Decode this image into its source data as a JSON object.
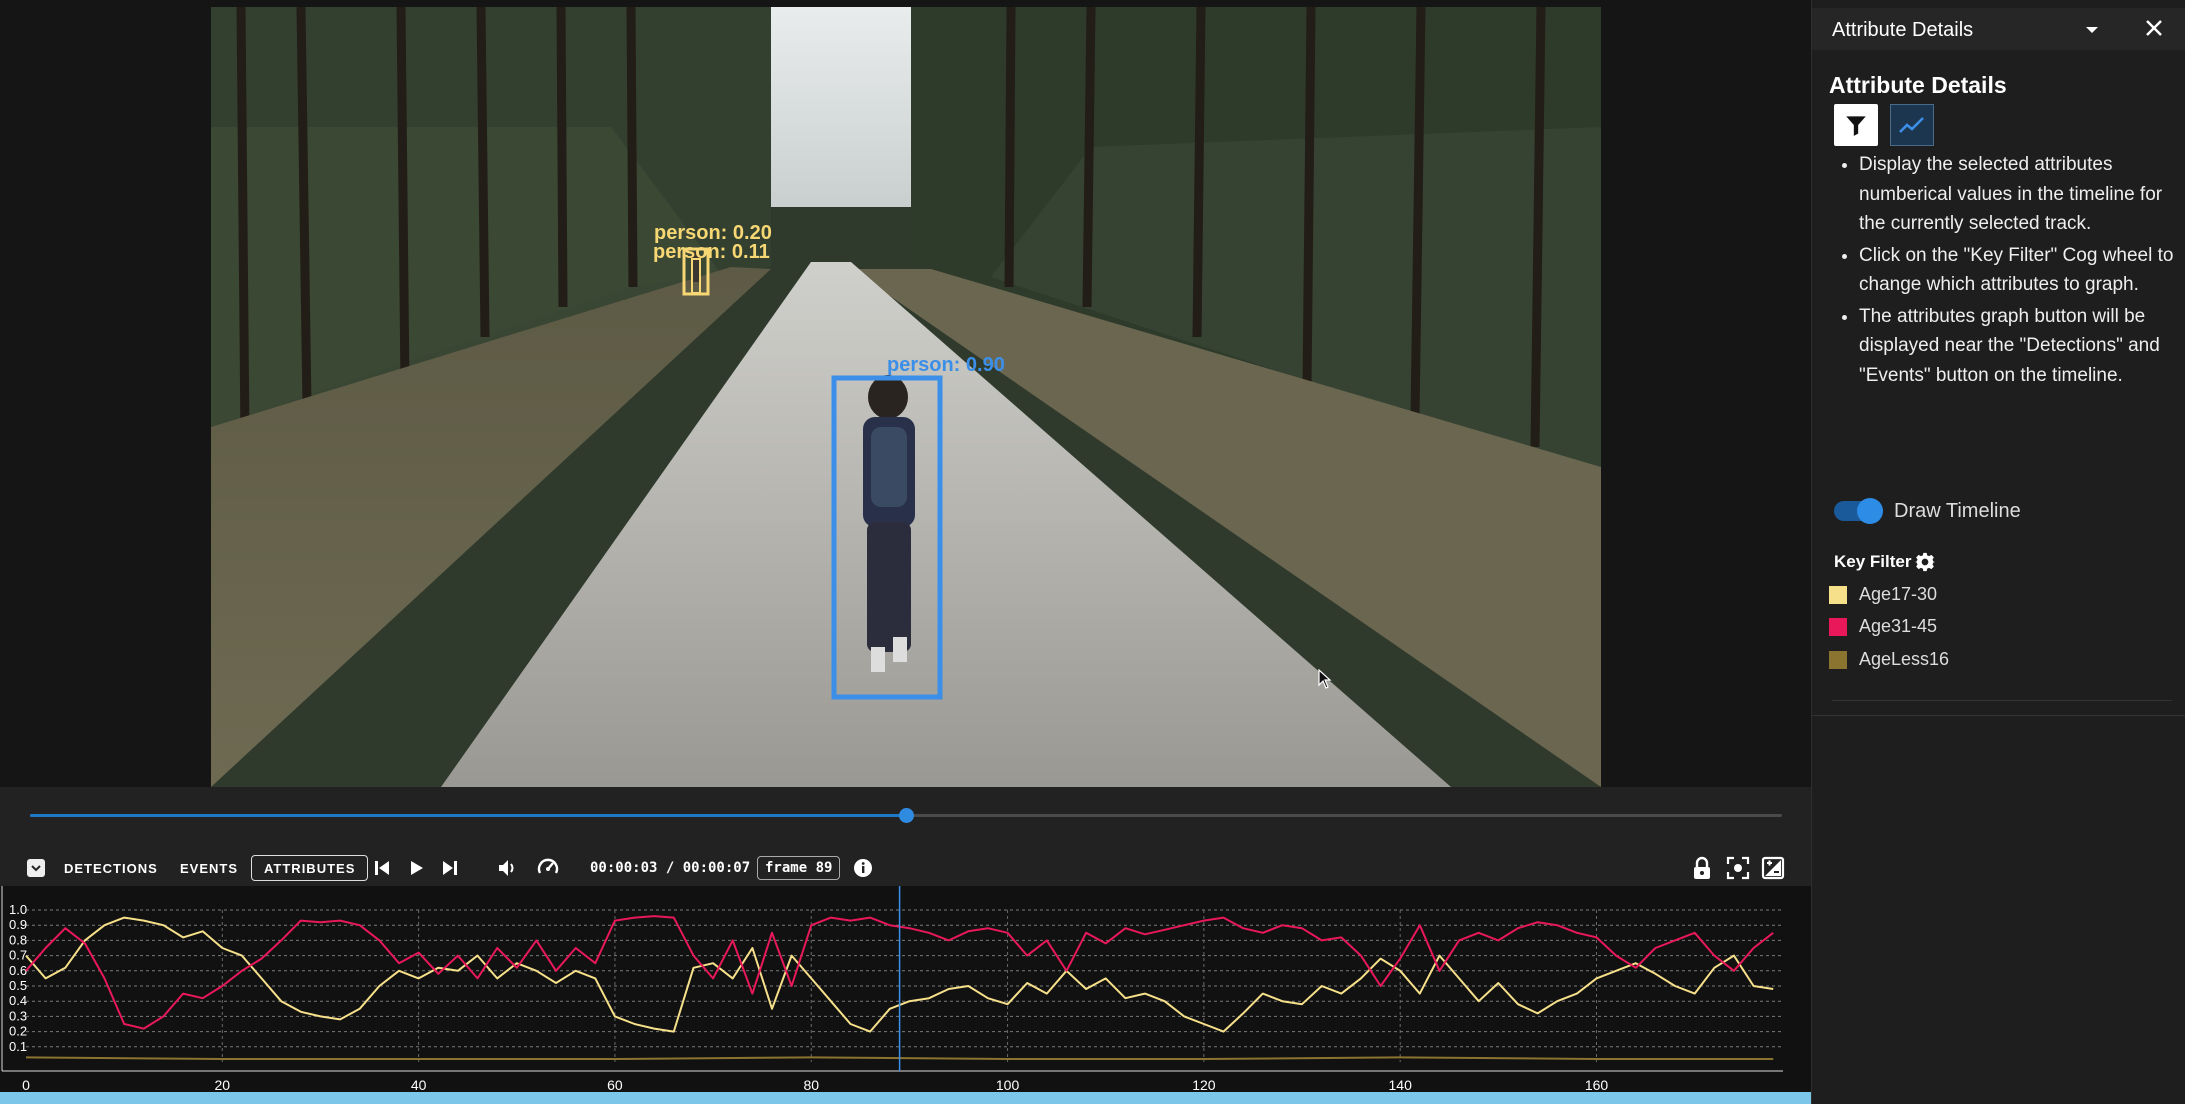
{
  "video": {
    "detections": [
      {
        "label": "person: 0.20",
        "color": "#f7d774"
      },
      {
        "label": "person: 0.11",
        "color": "#f7d774"
      },
      {
        "label": "person: 0.90",
        "color": "#3b8fe8"
      }
    ]
  },
  "controls": {
    "tabs": [
      "DETECTIONS",
      "EVENTS",
      "ATTRIBUTES"
    ],
    "active_tab": "ATTRIBUTES",
    "time": "00:00:03 / 00:00:07",
    "frame": "frame 89",
    "seek_progress": 0.5
  },
  "timeline": {
    "x_ticks": [
      "0",
      "20",
      "40",
      "60",
      "80",
      "100",
      "120",
      "140",
      "160"
    ],
    "y_ticks": [
      "1.0",
      "0.9",
      "0.8",
      "0.7",
      "0.6",
      "0.5",
      "0.4",
      "0.3",
      "0.2",
      "0.1"
    ]
  },
  "chart_data": {
    "type": "line",
    "xlim": [
      0,
      179
    ],
    "ylim": [
      0,
      1.0
    ],
    "grid": true,
    "cursor_frame": 89,
    "series": [
      {
        "name": "Age17-30",
        "color": "#f7e08a",
        "x": [
          0,
          2,
          4,
          6,
          8,
          10,
          12,
          14,
          16,
          18,
          20,
          22,
          24,
          26,
          28,
          30,
          32,
          34,
          36,
          38,
          40,
          42,
          44,
          46,
          48,
          50,
          52,
          54,
          56,
          58,
          60,
          62,
          64,
          66,
          68,
          70,
          72,
          74,
          76,
          78,
          80,
          82,
          84,
          86,
          88,
          90,
          92,
          94,
          96,
          98,
          100,
          102,
          104,
          106,
          108,
          110,
          112,
          114,
          116,
          118,
          120,
          122,
          124,
          126,
          128,
          130,
          132,
          134,
          136,
          138,
          140,
          142,
          144,
          146,
          148,
          150,
          152,
          154,
          156,
          158,
          160,
          162,
          164,
          166,
          168,
          170,
          172,
          174,
          176,
          178
        ],
        "values": [
          0.7,
          0.55,
          0.62,
          0.8,
          0.9,
          0.95,
          0.93,
          0.9,
          0.82,
          0.86,
          0.75,
          0.7,
          0.55,
          0.4,
          0.33,
          0.3,
          0.28,
          0.35,
          0.5,
          0.6,
          0.55,
          0.62,
          0.6,
          0.7,
          0.55,
          0.65,
          0.6,
          0.52,
          0.6,
          0.55,
          0.3,
          0.25,
          0.22,
          0.2,
          0.62,
          0.65,
          0.55,
          0.75,
          0.35,
          0.7,
          0.55,
          0.4,
          0.25,
          0.2,
          0.35,
          0.4,
          0.42,
          0.48,
          0.5,
          0.42,
          0.38,
          0.52,
          0.45,
          0.6,
          0.48,
          0.55,
          0.42,
          0.45,
          0.4,
          0.3,
          0.25,
          0.2,
          0.32,
          0.45,
          0.4,
          0.38,
          0.5,
          0.45,
          0.55,
          0.68,
          0.6,
          0.45,
          0.7,
          0.55,
          0.4,
          0.52,
          0.38,
          0.32,
          0.4,
          0.45,
          0.55,
          0.6,
          0.65,
          0.58,
          0.5,
          0.45,
          0.62,
          0.7,
          0.5,
          0.48
        ]
      },
      {
        "name": "Age31-45",
        "color": "#e8185a",
        "x": [
          0,
          2,
          4,
          6,
          8,
          10,
          12,
          14,
          16,
          18,
          20,
          22,
          24,
          26,
          28,
          30,
          32,
          34,
          36,
          38,
          40,
          42,
          44,
          46,
          48,
          50,
          52,
          54,
          56,
          58,
          60,
          62,
          64,
          66,
          68,
          70,
          72,
          74,
          76,
          78,
          80,
          82,
          84,
          86,
          88,
          90,
          92,
          94,
          96,
          98,
          100,
          102,
          104,
          106,
          108,
          110,
          112,
          114,
          116,
          118,
          120,
          122,
          124,
          126,
          128,
          130,
          132,
          134,
          136,
          138,
          140,
          142,
          144,
          146,
          148,
          150,
          152,
          154,
          156,
          158,
          160,
          162,
          164,
          166,
          168,
          170,
          172,
          174,
          176,
          178
        ],
        "values": [
          0.6,
          0.75,
          0.88,
          0.78,
          0.55,
          0.25,
          0.22,
          0.3,
          0.45,
          0.42,
          0.5,
          0.6,
          0.68,
          0.8,
          0.93,
          0.92,
          0.93,
          0.9,
          0.8,
          0.65,
          0.72,
          0.58,
          0.7,
          0.55,
          0.75,
          0.62,
          0.8,
          0.6,
          0.75,
          0.65,
          0.93,
          0.95,
          0.96,
          0.95,
          0.7,
          0.55,
          0.8,
          0.45,
          0.85,
          0.5,
          0.9,
          0.95,
          0.93,
          0.95,
          0.9,
          0.88,
          0.85,
          0.8,
          0.86,
          0.88,
          0.85,
          0.7,
          0.8,
          0.6,
          0.85,
          0.78,
          0.88,
          0.84,
          0.87,
          0.9,
          0.93,
          0.95,
          0.88,
          0.85,
          0.9,
          0.88,
          0.8,
          0.82,
          0.7,
          0.5,
          0.68,
          0.9,
          0.6,
          0.8,
          0.85,
          0.8,
          0.88,
          0.92,
          0.9,
          0.85,
          0.82,
          0.7,
          0.62,
          0.75,
          0.8,
          0.85,
          0.7,
          0.6,
          0.75,
          0.85
        ]
      },
      {
        "name": "AgeLess16",
        "color": "#8a7430",
        "x": [
          0,
          20,
          40,
          60,
          80,
          100,
          120,
          140,
          160,
          178
        ],
        "values": [
          0.03,
          0.02,
          0.02,
          0.02,
          0.03,
          0.02,
          0.02,
          0.03,
          0.02,
          0.02
        ]
      }
    ]
  },
  "panel": {
    "header_title": "Attribute Details",
    "heading": "Attribute Details",
    "help": [
      "Display the selected attributes numberical values in the timeline for the currently selected track.",
      "Click on the \"Key Filter\" Cog wheel to change which attributes to graph.",
      "The attributes graph button will be displayed near the \"Detections\" and \"Events\" button on the timeline."
    ],
    "toggle_label": "Draw Timeline",
    "toggle_on": true,
    "key_filter_label": "Key Filter",
    "keys": [
      {
        "label": "Age17-30",
        "color": "#f7e08a"
      },
      {
        "label": "Age31-45",
        "color": "#e8185a"
      },
      {
        "label": "AgeLess16",
        "color": "#8a7430"
      }
    ]
  }
}
